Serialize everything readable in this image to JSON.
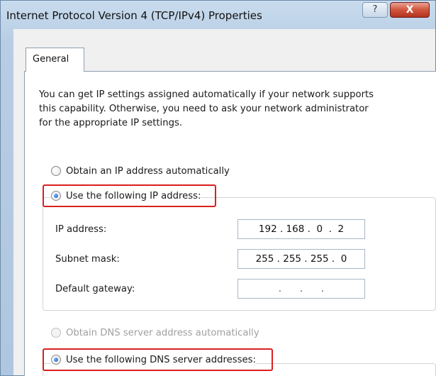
{
  "window": {
    "title": "Internet Protocol Version 4 (TCP/IPv4) Properties",
    "help_label": "?",
    "close_label": "X"
  },
  "tabs": [
    {
      "label": "General",
      "selected": true
    }
  ],
  "description": "You can get IP settings assigned automatically if your network supports\nthis capability. Otherwise, you need to ask your network administrator\nfor the appropriate IP settings.",
  "ip_mode": {
    "auto_label": "Obtain an IP address automatically",
    "auto_selected": false,
    "manual_label": "Use the following IP address:",
    "manual_selected": true
  },
  "fields": [
    {
      "label": "IP address:",
      "value": "192 . 168 .  0  .  2"
    },
    {
      "label": "Subnet mask:",
      "value": "255 . 255 . 255 .  0"
    },
    {
      "label": "Default gateway:",
      "value": "  .      .      .  "
    }
  ],
  "dns_mode": {
    "auto_label": "Obtain DNS server address automatically",
    "auto_enabled": false,
    "manual_label": "Use the following DNS server addresses:",
    "manual_selected": true
  },
  "colors": {
    "highlight": "#d9201f",
    "title_bar": "#b7cde4",
    "close_button": "#d0543c"
  }
}
